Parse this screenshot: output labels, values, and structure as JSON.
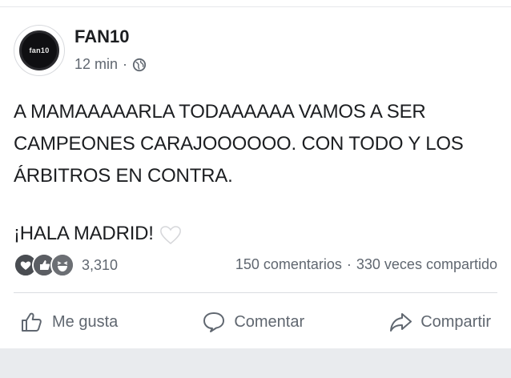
{
  "post": {
    "author": "FAN10",
    "avatar_text": "fan10",
    "time": "12 min",
    "audience_icon": "globe-icon",
    "text_lines": [
      "A MAMAAAAARLA TODAAAAAA VAMOS A SER",
      "CAMPEONES CARAJOOOOOO. CON TODO Y LOS",
      "ÁRBITROS EN CONTRA."
    ],
    "closing_line": "¡HALA MADRID!",
    "closing_icon": "white-heart-icon"
  },
  "stats": {
    "reaction_icons": [
      "love-reaction-icon",
      "like-reaction-icon",
      "haha-reaction-icon"
    ],
    "reaction_count": "3,310",
    "comments": "150 comentarios",
    "shares": "330 veces compartido"
  },
  "actions": {
    "like": "Me gusta",
    "comment": "Comentar",
    "share": "Compartir"
  },
  "colors": {
    "text": "#1c1e21",
    "secondary_text": "#606770",
    "divider": "#dadde1",
    "bottom_bar": "#e9ebee"
  }
}
